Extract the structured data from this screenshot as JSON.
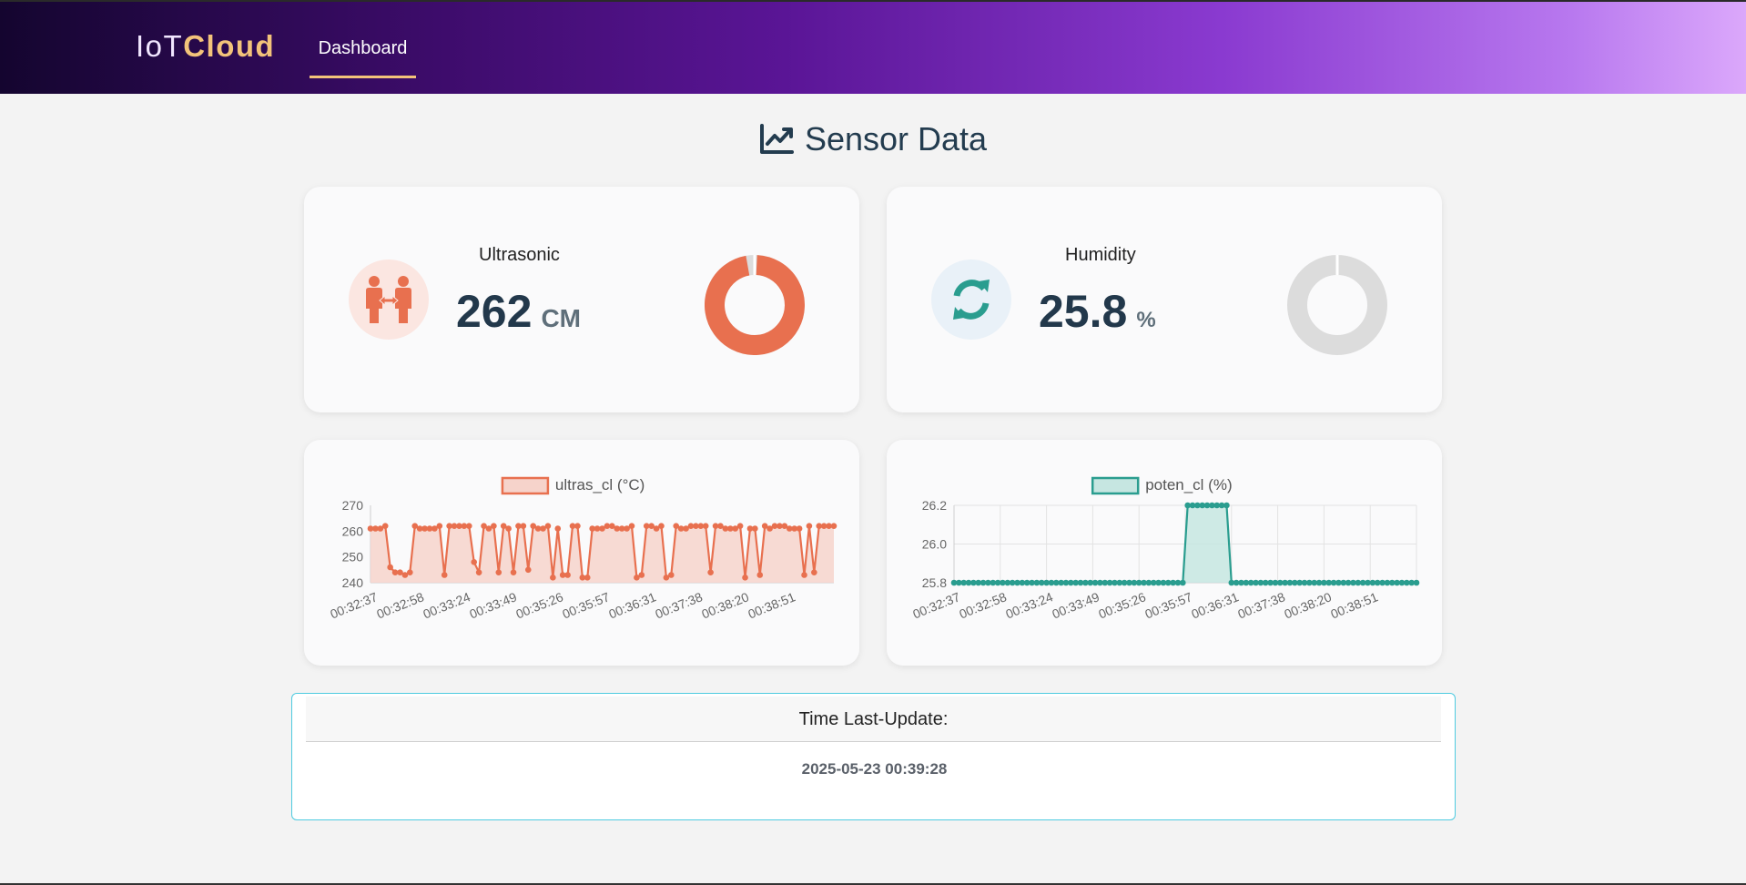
{
  "nav": {
    "brand_prefix": "IoT",
    "brand_accent": "Cloud",
    "tab_dashboard": "Dashboard"
  },
  "page": {
    "title": "Sensor Data",
    "title_icon": "line-chart-icon"
  },
  "sensors": {
    "ultrasonic": {
      "label": "Ultrasonic",
      "value": "262",
      "unit": "CM",
      "icon": "people-distance-icon",
      "color": "#e8704f",
      "gauge_fraction": 0.98
    },
    "humidity": {
      "label": "Humidity",
      "value": "25.8",
      "unit": "%",
      "icon": "sync-arrows-icon",
      "color": "#2a9d8f",
      "gauge_fraction": 0.0
    }
  },
  "chart_data": [
    {
      "type": "line",
      "series": [
        {
          "name": "ultras_cl (°C)",
          "color": "#e8704f",
          "fill": "#f6d3cb",
          "values": [
            261,
            261,
            261,
            262,
            246,
            244,
            244,
            243,
            244,
            262,
            261,
            261,
            261,
            261,
            262,
            243,
            262,
            262,
            262,
            262,
            262,
            248,
            244,
            262,
            261,
            262,
            244,
            262,
            261,
            244,
            262,
            262,
            245,
            262,
            261,
            261,
            262,
            242,
            261,
            243,
            243,
            262,
            262,
            242,
            242,
            261,
            261,
            261,
            262,
            262,
            261,
            261,
            261,
            262,
            242,
            243,
            262,
            262,
            261,
            262,
            242,
            243,
            262,
            261,
            261,
            262,
            262,
            262,
            262,
            244,
            262,
            262,
            261,
            261,
            261,
            262,
            242,
            261,
            261,
            243,
            262,
            261,
            262,
            262,
            262,
            261,
            261,
            261,
            243,
            262,
            244,
            262,
            262,
            262,
            262
          ]
        }
      ],
      "x_tick_labels": [
        "00:32:37",
        "00:32:58",
        "00:33:24",
        "00:33:49",
        "00:35:26",
        "00:35:57",
        "00:36:31",
        "00:37:38",
        "00:38:20",
        "00:38:51"
      ],
      "y_ticks": [
        240,
        250,
        260,
        270
      ],
      "ylim": [
        240,
        270
      ],
      "grid": false,
      "legend": "top"
    },
    {
      "type": "line",
      "series": [
        {
          "name": "poten_cl (%)",
          "color": "#2a9d8f",
          "fill": "#c6e6e1",
          "values": [
            25.8,
            25.8,
            25.8,
            25.8,
            25.8,
            25.8,
            25.8,
            25.8,
            25.8,
            25.8,
            25.8,
            25.8,
            25.8,
            25.8,
            25.8,
            25.8,
            25.8,
            25.8,
            25.8,
            25.8,
            25.8,
            25.8,
            25.8,
            25.8,
            25.8,
            25.8,
            25.8,
            25.8,
            25.8,
            25.8,
            25.8,
            25.8,
            25.8,
            25.8,
            25.8,
            25.8,
            25.8,
            25.8,
            25.8,
            25.8,
            25.8,
            25.8,
            25.8,
            25.8,
            25.8,
            25.8,
            25.8,
            25.8,
            26.2,
            26.2,
            26.2,
            26.2,
            26.2,
            26.2,
            26.2,
            26.2,
            26.2,
            25.8,
            25.8,
            25.8,
            25.8,
            25.8,
            25.8,
            25.8,
            25.8,
            25.8,
            25.8,
            25.8,
            25.8,
            25.8,
            25.8,
            25.8,
            25.8,
            25.8,
            25.8,
            25.8,
            25.8,
            25.8,
            25.8,
            25.8,
            25.8,
            25.8,
            25.8,
            25.8,
            25.8,
            25.8,
            25.8,
            25.8,
            25.8,
            25.8,
            25.8,
            25.8,
            25.8,
            25.8,
            25.8,
            25.8
          ]
        }
      ],
      "x_tick_labels": [
        "00:32:37",
        "00:32:58",
        "00:33:24",
        "00:33:49",
        "00:35:26",
        "00:35:57",
        "00:36:31",
        "00:37:38",
        "00:38:20",
        "00:38:51"
      ],
      "y_ticks": [
        25.8,
        26.0,
        26.2
      ],
      "y_tick_labels": [
        "25.8",
        "26.0",
        "26.2"
      ],
      "ylim": [
        25.8,
        26.2
      ],
      "grid": true,
      "legend": "top"
    }
  ],
  "update": {
    "header": "Time Last-Update:",
    "timestamp": "2025-05-23 00:39:28"
  }
}
